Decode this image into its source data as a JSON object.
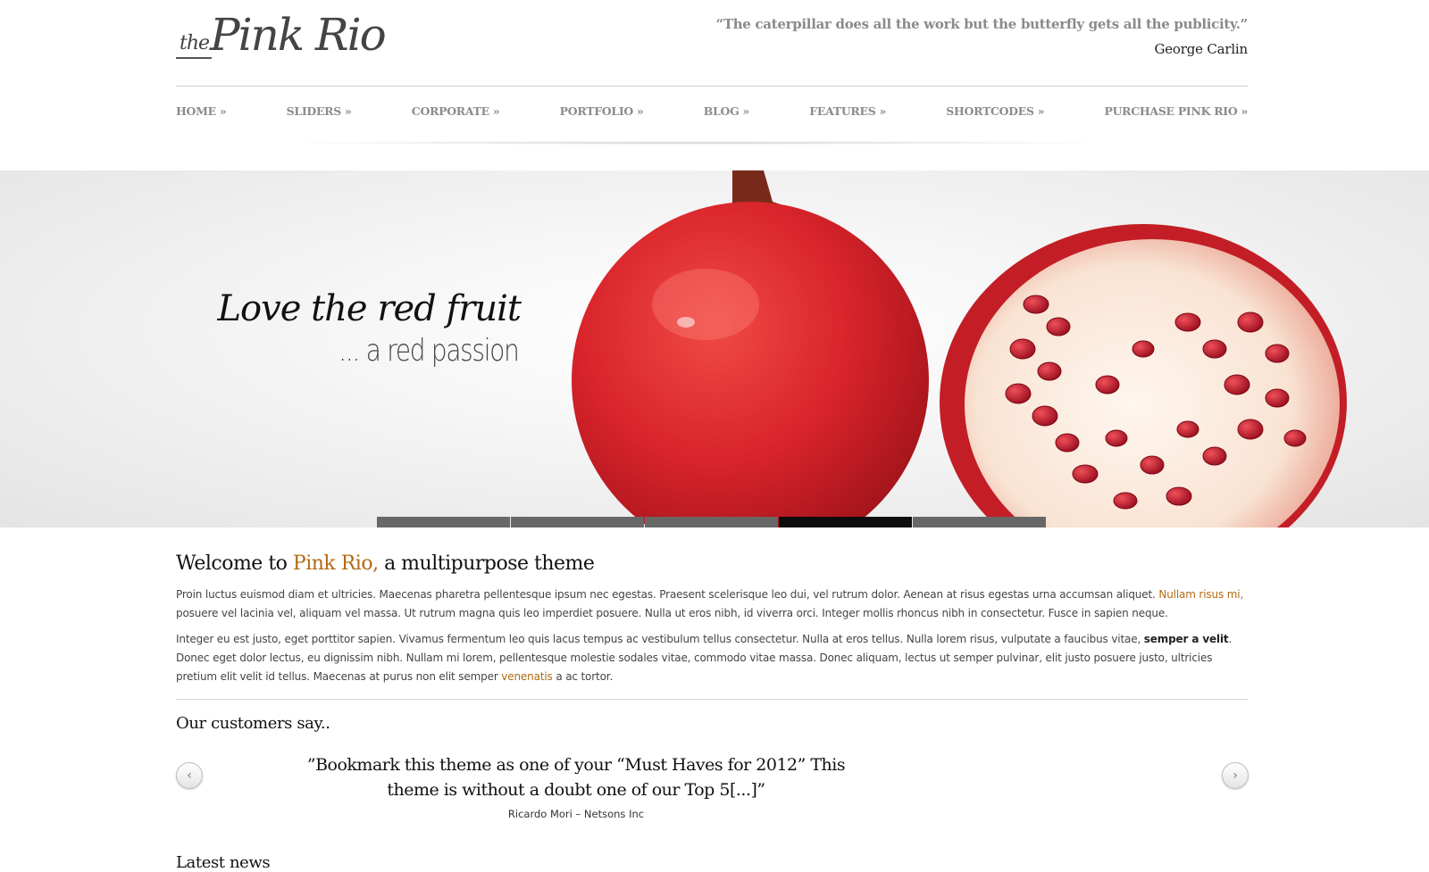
{
  "header": {
    "logo_small": "the",
    "logo_main": "Pink Rio",
    "quote": "“The caterpillar does all the work but the butterfly gets all the publicity.”",
    "quote_author": "George Carlin"
  },
  "nav": {
    "items": [
      {
        "label": "HOME »"
      },
      {
        "label": "SLIDERS »"
      },
      {
        "label": "CORPORATE »"
      },
      {
        "label": "PORTFOLIO »"
      },
      {
        "label": "BLOG »"
      },
      {
        "label": "FEATURES »"
      },
      {
        "label": "SHORTCODES »"
      },
      {
        "label": "PURCHASE PINK RIO »"
      }
    ]
  },
  "slider": {
    "title": "Love the red fruit",
    "subtitle": "... a red passion",
    "slide_count": 5,
    "active_slide": 4
  },
  "welcome": {
    "prefix": "Welcome to ",
    "accent": "Pink Rio,",
    "suffix": " a multipurpose theme",
    "p1_a": "Proin luctus euismod diam et ultricies. Maecenas pharetra pellentesque ipsum nec egestas. Praesent scelerisque leo dui, vel rutrum dolor. Aenean at risus egestas urna accumsan aliquet. ",
    "p1_link": "Nullam risus mi,",
    "p1_b": " posuere vel lacinia vel, aliquam vel massa. Ut rutrum magna quis leo imperdiet posuere. Nulla ut eros nibh, id viverra orci. Integer mollis rhoncus nibh in consectetur. Fusce in sapien neque.",
    "p2_a": "Integer eu est justo, eget porttitor sapien. Vivamus fermentum leo quis lacus tempus ac vestibulum tellus consectetur. Nulla at eros tellus. Nulla lorem risus, vulputate a faucibus vitae, ",
    "p2_bold": "semper a velit",
    "p2_b": ". Donec eget dolor lectus, eu dignissim nibh. Nullam mi lorem, pellentesque molestie sodales vitae, commodo vitae massa. Donec aliquam, lectus ut semper pulvinar, elit justo posuere justo, ultricies pretium elit velit id tellus. Maecenas at purus non elit semper ",
    "p2_link": "venenatis",
    "p2_c": " a ac tortor."
  },
  "testimonials": {
    "heading": "Our customers say..",
    "text": "”Bookmark this theme as one of your “Must Haves for 2012” This theme is without a doubt one of our Top 5[...]”",
    "author": "Ricardo Mori – Netsons Inc",
    "prev_icon": "chevron-left-icon",
    "next_icon": "chevron-right-icon"
  },
  "news": {
    "heading": "Latest news"
  },
  "colors": {
    "accent": "#b26a12",
    "pager": "#676767",
    "pager_active": "#0d0d0d"
  }
}
